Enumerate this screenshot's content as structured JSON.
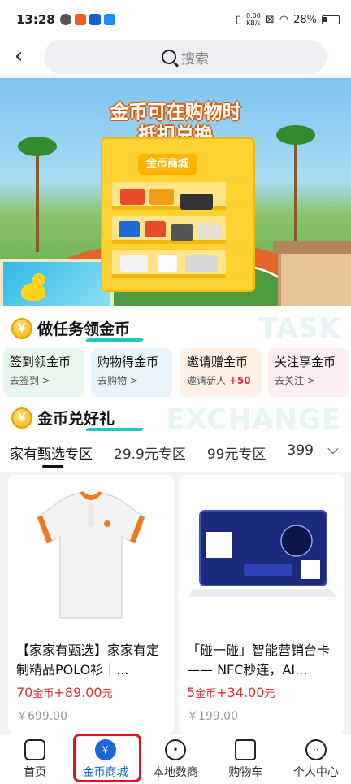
{
  "status_bar": {
    "time": "13:28",
    "net_speed_value": "0.00",
    "net_speed_unit": "KB/s",
    "battery": "28%"
  },
  "topnav": {
    "back_icon": "chevron-left-icon",
    "search_placeholder": "搜索"
  },
  "banner": {
    "headline_line1": "金币可在购物时",
    "headline_line2": "抵扣兑换",
    "bag_label": "金币商城"
  },
  "task_section": {
    "title": "做任务领金币",
    "ghost_text": "TASK",
    "cards": [
      {
        "title": "签到领金币",
        "sub": "去签到 >",
        "bg": "#e8f7ee"
      },
      {
        "title": "购物得金币",
        "sub": "去购物 >",
        "bg": "#e7f5fb"
      },
      {
        "title": "邀请赠金币",
        "sub": "邀请新人",
        "bonus": "+50",
        "bg": "#fff1e6"
      },
      {
        "title": "关注享金币",
        "sub": "去关注 >",
        "bg": "#fdeef1"
      }
    ]
  },
  "exchange_section": {
    "title": "金币兑好礼",
    "ghost_text": "EXCHANGE",
    "tabs": [
      "家有甄选专区",
      "29.9元专区",
      "99元专区",
      "399"
    ],
    "active_tab": 0
  },
  "products": [
    {
      "name": "【家家有甄选】家家有定制精品POLO衫｜...",
      "coins": "70",
      "coin_unit": "金币",
      "cash": "+89.00",
      "cash_unit": "元",
      "original": "￥699.00"
    },
    {
      "name": "「碰一碰」智能营销台卡 —— NFC秒连，AI...",
      "coins": "5",
      "coin_unit": "金币",
      "cash": "+34.00",
      "cash_unit": "元",
      "original": "￥199.00"
    }
  ],
  "bottom_nav": {
    "items": [
      {
        "label": "首页",
        "icon": "home-icon"
      },
      {
        "label": "金币商城",
        "icon": "yuan-coin-icon"
      },
      {
        "label": "本地数商",
        "icon": "location-icon"
      },
      {
        "label": "购物车",
        "icon": "cart-icon"
      },
      {
        "label": "个人中心",
        "icon": "profile-icon"
      }
    ],
    "active_index": 1
  },
  "colors": {
    "accent_blue": "#1b66d6",
    "price_red": "#e23232",
    "highlight_red": "#e1131b",
    "teal_underline": "#24c7c0"
  }
}
